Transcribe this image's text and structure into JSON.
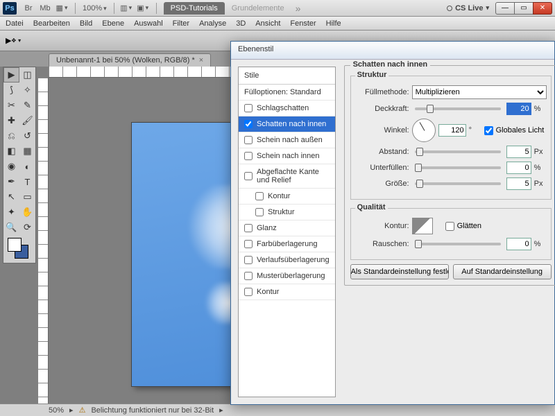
{
  "top": {
    "ps": "Ps",
    "br": "Br",
    "mb": "Mb",
    "zoom": "100%",
    "psd_tab": "PSD-Tutorials",
    "grund": "Grundelemente",
    "cslive": "CS Live"
  },
  "menu": [
    "Datei",
    "Bearbeiten",
    "Bild",
    "Ebene",
    "Auswahl",
    "Filter",
    "Analyse",
    "3D",
    "Ansicht",
    "Fenster",
    "Hilfe"
  ],
  "doc_tab": "Unbenannt-1 bei 50% (Wolken, RGB/8) *",
  "status": {
    "zoom": "50%",
    "msg": "Belichtung funktioniert nur bei 32-Bit"
  },
  "dialog": {
    "title": "Ebenenstil",
    "list_header": "Stile",
    "fill_opts": "Fülloptionen: Standard",
    "items": [
      {
        "label": "Schlagschatten",
        "checked": false
      },
      {
        "label": "Schatten nach innen",
        "checked": true,
        "selected": true
      },
      {
        "label": "Schein nach außen",
        "checked": false
      },
      {
        "label": "Schein nach innen",
        "checked": false
      },
      {
        "label": "Abgeflachte Kante und Relief",
        "checked": false
      },
      {
        "label": "Kontur",
        "checked": false,
        "indent": true
      },
      {
        "label": "Struktur",
        "checked": false,
        "indent": true
      },
      {
        "label": "Glanz",
        "checked": false
      },
      {
        "label": "Farbüberlagerung",
        "checked": false
      },
      {
        "label": "Verlaufsüberlagerung",
        "checked": false
      },
      {
        "label": "Musterüberlagerung",
        "checked": false
      },
      {
        "label": "Kontur",
        "checked": false
      }
    ],
    "panel_title": "Schatten nach innen",
    "struktur": "Struktur",
    "qualitaet": "Qualität",
    "fuellmethode_lbl": "Füllmethode:",
    "fuellmethode_val": "Multiplizieren",
    "deckkraft_lbl": "Deckkraft:",
    "deckkraft_val": "20",
    "winkel_lbl": "Winkel:",
    "winkel_val": "120",
    "global_lbl": "Globales Licht",
    "abstand_lbl": "Abstand:",
    "abstand_val": "5",
    "unterf_lbl": "Unterfüllen:",
    "unterf_val": "0",
    "groesse_lbl": "Größe:",
    "groesse_val": "5",
    "kontur_lbl": "Kontur:",
    "glaetten_lbl": "Glätten",
    "rauschen_lbl": "Rauschen:",
    "rauschen_val": "0",
    "pct": "%",
    "px": "Px",
    "deg": "°",
    "btn_default": "Als Standardeinstellung festlegen",
    "btn_reset": "Auf Standardeinstellung"
  }
}
